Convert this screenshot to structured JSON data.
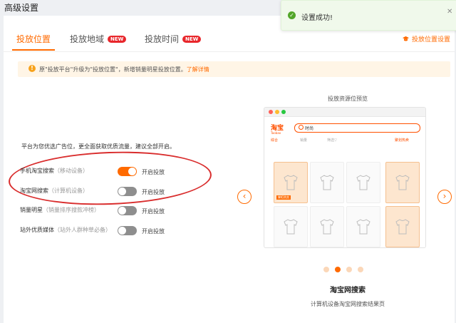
{
  "page": {
    "title": "高级设置"
  },
  "toast": {
    "message": "设置成功!",
    "icon": "check-circle-icon",
    "close_icon": "close-icon"
  },
  "tabs": [
    {
      "label": "投放位置",
      "active": true,
      "badge": ""
    },
    {
      "label": "投放地域",
      "active": false,
      "badge": "NEW"
    },
    {
      "label": "投放时间",
      "active": false,
      "badge": "NEW"
    }
  ],
  "header_link": {
    "label": "投放位置设置",
    "icon": "graduation-cap-icon"
  },
  "notice": {
    "text": "原\"投放平台\"升级为\"投放位置\"，新增销量明星投放位置。",
    "link": "了解详情",
    "icon": "info-icon"
  },
  "intro": "平台为您优选广告位，更全面获取优质流量，建议全部开启。",
  "placements": [
    {
      "name": "手机淘宝搜索",
      "sub": "（移动设备）",
      "on": true,
      "toggle_label": "开启投放"
    },
    {
      "name": "淘宝网搜索",
      "sub": "（计算机设备）",
      "on": false,
      "toggle_label": "开启投放"
    },
    {
      "name": "销量明星",
      "sub": "（销量排序搜款冲榜）",
      "on": false,
      "toggle_label": "开启投放"
    },
    {
      "name": "站外优质媒体",
      "sub": "（站外人群种草必备）",
      "on": false,
      "toggle_label": "开启投放"
    }
  ],
  "preview": {
    "title": "投放资源位预览",
    "logo": "淘宝",
    "logo_sub": "Taobao",
    "search_keyword": "时尚",
    "filters": [
      "综合",
      "销量",
      "筛选▽",
      "聚划热卖"
    ],
    "ad_tag": "掌柜热卖",
    "caption_title": "淘宝网搜索",
    "caption_desc": "计算机设备淘宝网搜索结果页",
    "carousel_total": 4,
    "carousel_active": 1,
    "prev_icon": "chevron-left-icon",
    "next_icon": "chevron-right-icon",
    "colors": {
      "accent": "#ff6a00",
      "brand": "#ff5000",
      "badge": "#e8262b",
      "success": "#52a629"
    }
  }
}
